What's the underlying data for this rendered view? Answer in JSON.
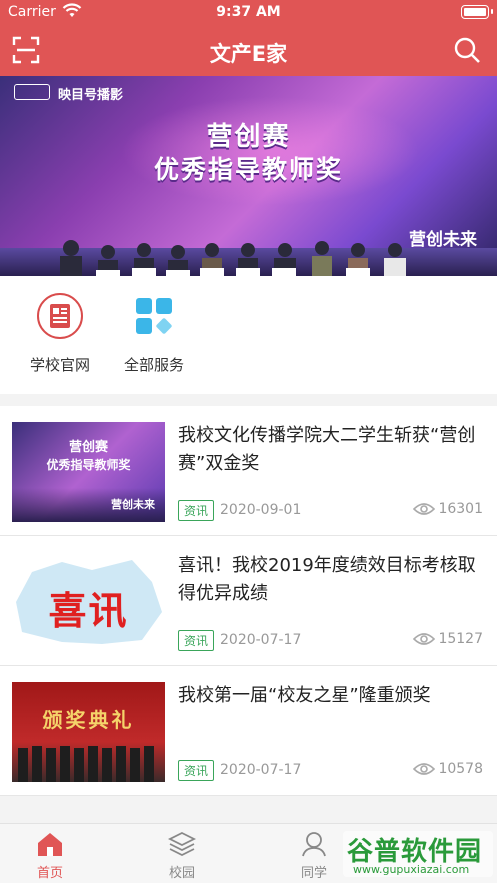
{
  "status_bar": {
    "carrier": "Carrier",
    "time": "9:37 AM"
  },
  "header": {
    "title": "文产E家",
    "left_icon": "scan-icon",
    "right_icon": "search-icon"
  },
  "banner": {
    "logo_text": "映目号播影",
    "headline_1": "营创赛",
    "headline_2": "优秀指导教师奖",
    "slogan": "营创未来"
  },
  "services": [
    {
      "label": "学校官网",
      "icon": "school-website-icon",
      "color": "#d94c4c"
    },
    {
      "label": "全部服务",
      "icon": "all-services-icon",
      "color": "#3bb6e8"
    }
  ],
  "news": [
    {
      "title": "我校文化传播学院大二学生斩获“营创赛”双金奖",
      "tag": "资讯",
      "date": "2020-09-01",
      "views": "16301",
      "thumb_caption_1": "营创赛",
      "thumb_caption_2": "优秀指导教师奖",
      "thumb_caption_3": "营创未来"
    },
    {
      "title": "喜讯！我校2019年度绩效目标考核取得优异成绩",
      "tag": "资讯",
      "date": "2020-07-17",
      "views": "15127",
      "thumb_caption_1": "喜讯"
    },
    {
      "title": "我校第一届“校友之星”隆重颁奖",
      "tag": "资讯",
      "date": "2020-07-17",
      "views": "10578",
      "thumb_caption_1": "颁奖典礼"
    }
  ],
  "tabbar": [
    {
      "label": "首页",
      "icon": "home-icon",
      "active": true
    },
    {
      "label": "校园",
      "icon": "layers-icon",
      "active": false
    },
    {
      "label": "同学",
      "icon": "person-icon",
      "active": false
    }
  ],
  "watermark": {
    "text": "谷普软件园",
    "url": "www.gupuxiazai.com"
  },
  "colors": {
    "primary": "#e05555",
    "tag_green": "#3aa55a",
    "muted": "#999999"
  }
}
